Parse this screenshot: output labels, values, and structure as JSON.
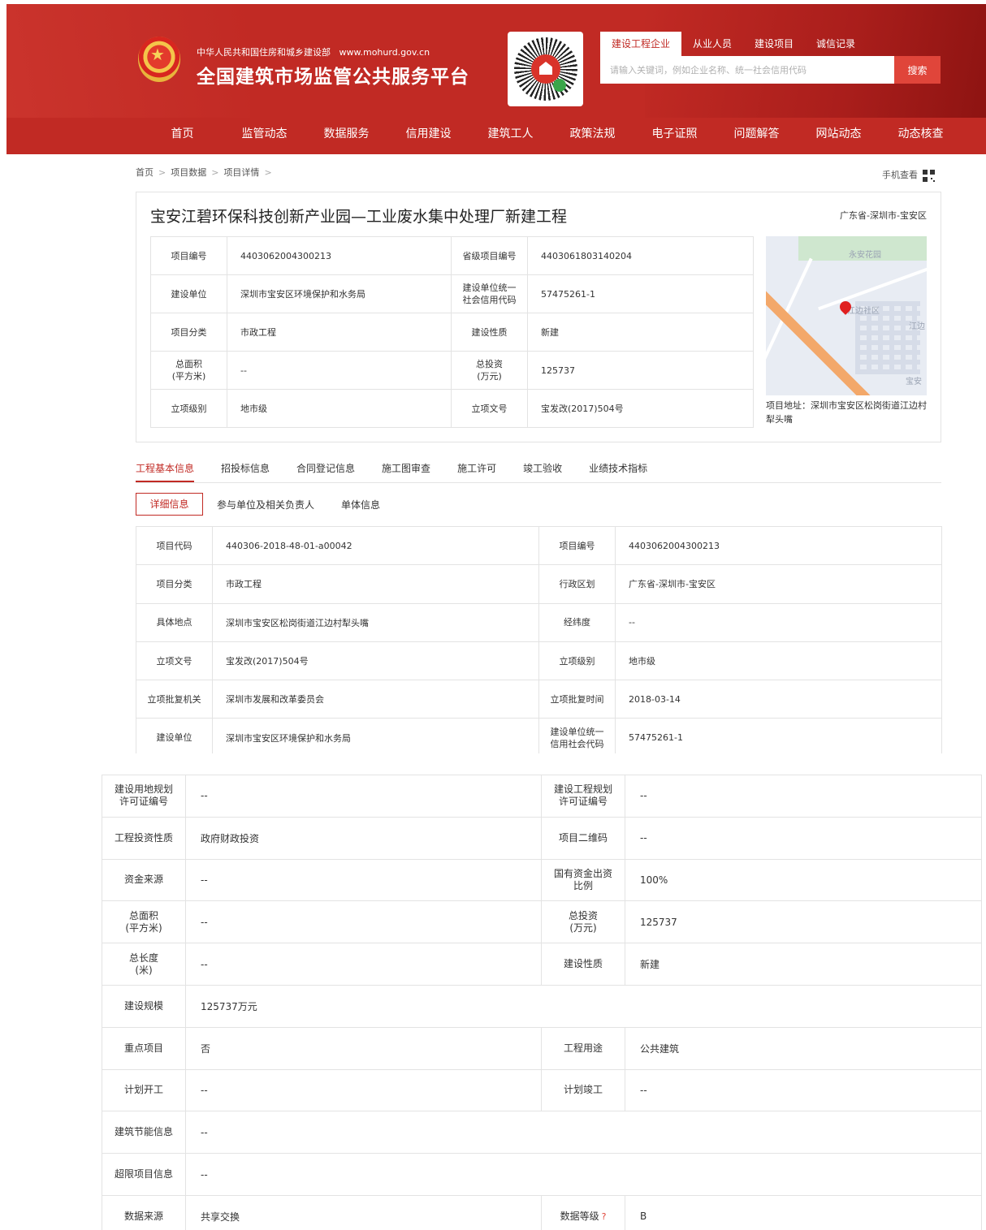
{
  "header": {
    "ministry": "中华人民共和国住房和城乡建设部",
    "site_url": "www.mohurd.gov.cn",
    "site_title": "全国建筑市场监管公共服务平台",
    "search_tabs": [
      "建设工程企业",
      "从业人员",
      "建设项目",
      "诚信记录"
    ],
    "search_placeholder": "请输入关键词，例如企业名称、统一社会信用代码",
    "search_button": "搜索",
    "nav": [
      "首页",
      "监管动态",
      "数据服务",
      "信用建设",
      "建筑工人",
      "政策法规",
      "电子证照",
      "问题解答",
      "网站动态",
      "动态核查"
    ]
  },
  "breadcrumb": [
    "首页",
    "项目数据",
    "项目详情"
  ],
  "mobile_view": "手机查看",
  "project": {
    "title": "宝安江碧环保科技创新产业园—工业废水集中处理厂新建工程",
    "region": "广东省-深圳市-宝安区",
    "rows": [
      [
        "项目编号",
        "4403062004300213",
        "省级项目编号",
        "4403061803140204"
      ],
      [
        "建设单位",
        "深圳市宝安区环境保护和水务局",
        "建设单位统一\n社会信用代码",
        "57475261-1"
      ],
      [
        "项目分类",
        "市政工程",
        "建设性质",
        "新建"
      ],
      [
        "总面积\n(平方米)",
        "--",
        "总投资\n(万元)",
        "125737"
      ],
      [
        "立项级别",
        "地市级",
        "立项文号",
        "宝发改(2017)504号"
      ]
    ],
    "map_labels": [
      "永安花园",
      "江边社区",
      "宝安",
      "江边"
    ],
    "address": "项目地址：深圳市宝安区松岗街道江边村犁头嘴"
  },
  "tabs": [
    "工程基本信息",
    "招投标信息",
    "合同登记信息",
    "施工图审查",
    "施工许可",
    "竣工验收",
    "业绩技术指标"
  ],
  "subtabs": [
    "详细信息",
    "参与单位及相关负责人",
    "单体信息"
  ],
  "detail_rows": [
    [
      "项目代码",
      "440306-2018-48-01-a00042",
      "项目编号",
      "4403062004300213"
    ],
    [
      "项目分类",
      "市政工程",
      "行政区划",
      "广东省-深圳市-宝安区"
    ],
    [
      "具体地点",
      "深圳市宝安区松岗街道江边村犁头嘴",
      "经纬度",
      "--"
    ],
    [
      "立项文号",
      "宝发改(2017)504号",
      "立项级别",
      "地市级"
    ],
    [
      "立项批复机关",
      "深圳市发展和改革委员会",
      "立项批复时间",
      "2018-03-14"
    ],
    [
      "建设单位",
      "深圳市宝安区环境保护和水务局",
      "建设单位统一\n信用社会代码",
      "57475261-1"
    ]
  ],
  "detail_rows2": [
    [
      "建设用地规划\n许可证编号",
      "--",
      "建设工程规划\n许可证编号",
      "--"
    ],
    [
      "工程投资性质",
      "政府财政投资",
      "项目二维码",
      "--"
    ],
    [
      "资金来源",
      "--",
      "国有资金出资\n比例",
      "100%"
    ],
    [
      "总面积\n(平方米)",
      "--",
      "总投资\n(万元)",
      "125737"
    ],
    [
      "总长度\n(米)",
      "--",
      "建设性质",
      "新建"
    ],
    [
      "建设规模",
      "125737万元"
    ],
    [
      "重点项目",
      "否",
      "工程用途",
      "公共建筑"
    ],
    [
      "计划开工",
      "--",
      "计划竣工",
      "--"
    ],
    [
      "建筑节能信息",
      "--"
    ],
    [
      "超限项目信息",
      "--"
    ],
    [
      "数据来源",
      "共享交换",
      "数据等级",
      "B"
    ]
  ],
  "help_mark": "?",
  "colors": {
    "brand_red": "#c12a24",
    "border": "#e3e3e3"
  }
}
